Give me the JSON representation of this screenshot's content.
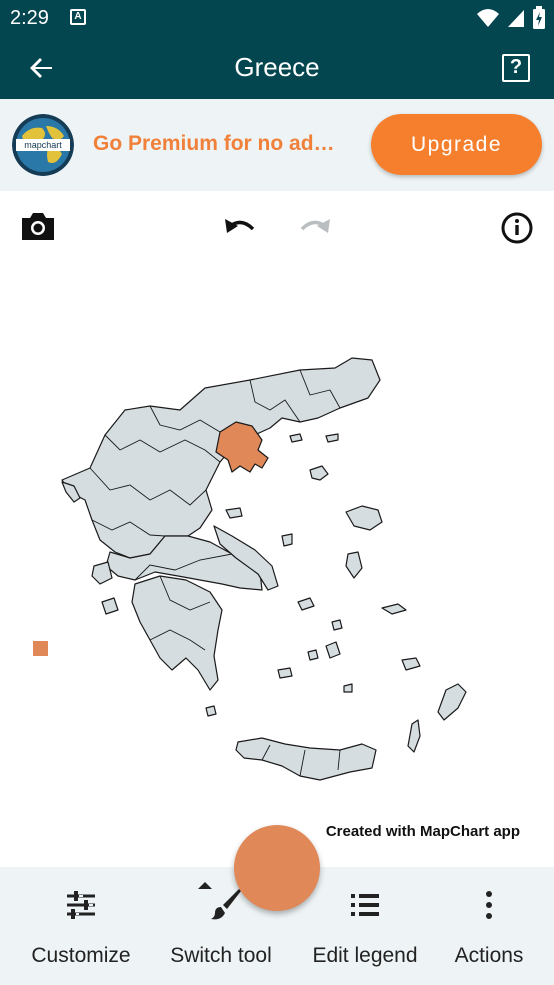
{
  "status_bar": {
    "time": "2:29",
    "notification_icon": "A"
  },
  "app_bar": {
    "title": "Greece"
  },
  "banner": {
    "promo_text": "Go Premium for no ad…",
    "upgrade_label": "Upgrade",
    "logo_text": "mapchart"
  },
  "map": {
    "credit": "Created with MapChart app",
    "highlight_color": "#e08858",
    "region_color": "#d5dde0"
  },
  "bottom_nav": [
    {
      "label": "Customize",
      "icon": "tune-icon"
    },
    {
      "label": "Switch tool",
      "icon": "brush-icon"
    },
    {
      "label": "Edit legend",
      "icon": "list-icon"
    },
    {
      "label": "Actions",
      "icon": "more-vert-icon"
    }
  ],
  "colors": {
    "primary": "#03464f",
    "accent": "#f57f2d",
    "promo_text": "#f0803a"
  }
}
